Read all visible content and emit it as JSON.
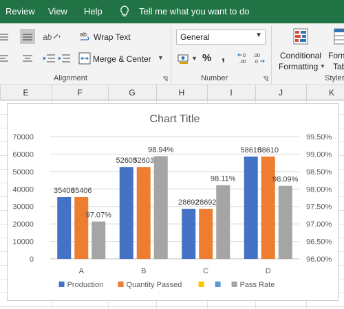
{
  "menu": {
    "review": "Review",
    "view": "View",
    "help": "Help",
    "tell_me": "Tell me what you want to do"
  },
  "ribbon": {
    "wrap_text": "Wrap Text",
    "merge_center": "Merge & Center",
    "alignment_group": "Alignment",
    "number_format": "General",
    "percent": "%",
    "comma": ",",
    "number_group": "Number",
    "conditional": "Conditional",
    "formatting": "Formatting",
    "format_partial": "Form",
    "table_partial": "Tab",
    "styles_group": "Styles"
  },
  "columns": [
    "E",
    "F",
    "G",
    "H",
    "I",
    "J",
    "K"
  ],
  "chart_data": {
    "type": "bar",
    "title": "Chart Title",
    "categories": [
      "A",
      "B",
      "C",
      "D"
    ],
    "series": [
      {
        "name": "Production",
        "color": "#4472C4",
        "values": [
          35406,
          52603,
          28692,
          58610
        ],
        "labels": [
          "35406",
          "52603",
          "28692",
          "58610"
        ]
      },
      {
        "name": "Quantity Passed",
        "color": "#ED7D31",
        "values": [
          35406,
          52603,
          28692,
          58610
        ],
        "labels": [
          "35406",
          "52603",
          "28692",
          "58610"
        ]
      },
      {
        "name": "Pass Rate",
        "color": "#A5A5A5",
        "axis": "right",
        "values": [
          97.07,
          98.94,
          98.11,
          98.09
        ],
        "labels": [
          "97.07%",
          "98.94%",
          "98.11%",
          "98.09%"
        ]
      }
    ],
    "legend": [
      {
        "name": "Production",
        "color": "#4472C4"
      },
      {
        "name": "Quantity Passed",
        "color": "#ED7D31"
      },
      {
        "name": "",
        "color": "#FFC000"
      },
      {
        "name": "",
        "color": "#5B9BD5"
      },
      {
        "name": "Pass Rate",
        "color": "#A5A5A5"
      }
    ],
    "ylim": [
      0,
      70000
    ],
    "yticks": [
      "0",
      "10000",
      "20000",
      "30000",
      "40000",
      "50000",
      "60000",
      "70000"
    ],
    "y2lim": [
      96.0,
      99.5
    ],
    "y2ticks": [
      "96.00%",
      "96.50%",
      "97.00%",
      "97.50%",
      "98.00%",
      "98.50%",
      "99.00%",
      "99.50%"
    ],
    "grid": true,
    "legend_position": "bottom"
  }
}
